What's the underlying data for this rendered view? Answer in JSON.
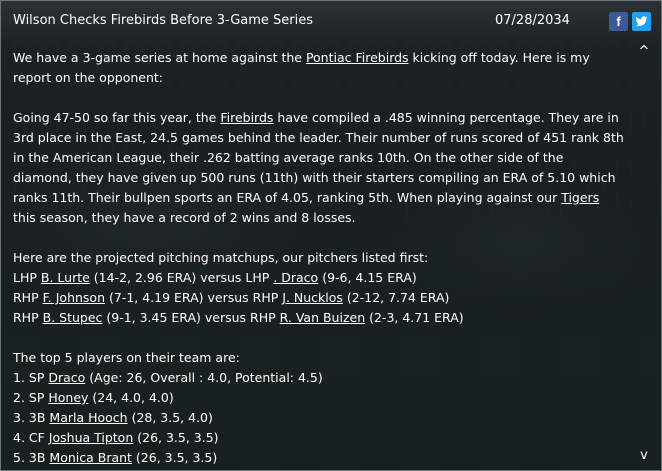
{
  "header": {
    "title": "Wilson Checks Firebirds Before 3-Game Series",
    "date": "07/28/2034",
    "facebook_label": "f"
  },
  "intro": {
    "prefix": "We have a 3-game series at home against the ",
    "team": "Pontiac Firebirds",
    "suffix": " kicking off today. Here is my report on the opponent:"
  },
  "report": {
    "p1": "Going 47-50 so far this year, the ",
    "team": "Firebirds",
    "p2": " have compiled a .485 winning percentage. They are in 3rd place in the East, 24.5 games behind the leader. Their number of runs scored of 451 rank 8th in the American League, their .262 batting average ranks 10th. On the other side of the diamond, they have given up 500 runs (11th) with their starters compiling an ERA of 5.10 which ranks 11th. Their bullpen sports an ERA of 4.05, ranking 5th. When playing against our ",
    "our_team": "Tigers",
    "p3": " this season, they have a record of 2 wins and 8 losses."
  },
  "matchups": {
    "heading": "Here are the projected pitching matchups, our pitchers listed first:",
    "rows": [
      {
        "our_hand": "LHP",
        "our_pitcher": "B. Lurte",
        "our_stats": " (14-2, 2.96 ERA) versus ",
        "opp_hand": "LHP",
        "opp_pitcher": ". Draco",
        "opp_stats": " (9-6, 4.15 ERA)"
      },
      {
        "our_hand": "RHP",
        "our_pitcher": "F. Johnson",
        "our_stats": " (7-1, 4.19 ERA) versus ",
        "opp_hand": "RHP",
        "opp_pitcher": "J. Nucklos",
        "opp_stats": " (2-12, 7.74 ERA)"
      },
      {
        "our_hand": "RHP",
        "our_pitcher": "B. Stupec",
        "our_stats": " (9-1, 3.45 ERA) versus ",
        "opp_hand": "RHP",
        "opp_pitcher": "R. Van Buizen",
        "opp_stats": " (2-3, 4.71 ERA)"
      }
    ]
  },
  "top_players": {
    "heading": "The top 5 players on their team are:",
    "rows": [
      {
        "prefix": "1. SP ",
        "name": " Draco",
        "stats": " (Age: 26, Overall : 4.0, Potential: 4.5)"
      },
      {
        "prefix": "2. SP ",
        "name": " Honey",
        "stats": " (24, 4.0, 4.0)"
      },
      {
        "prefix": "3. 3B ",
        "name": "Marla Hooch",
        "stats": " (28, 3.5, 4.0)"
      },
      {
        "prefix": "4. CF ",
        "name": "Joshua Tipton",
        "stats": " (26, 3.5, 3.5)"
      },
      {
        "prefix": "5. 3B ",
        "name": "Monica Brant",
        "stats": " (26, 3.5, 3.5)"
      }
    ]
  },
  "scroll": {
    "up_glyph": "^",
    "down_glyph": "v"
  }
}
